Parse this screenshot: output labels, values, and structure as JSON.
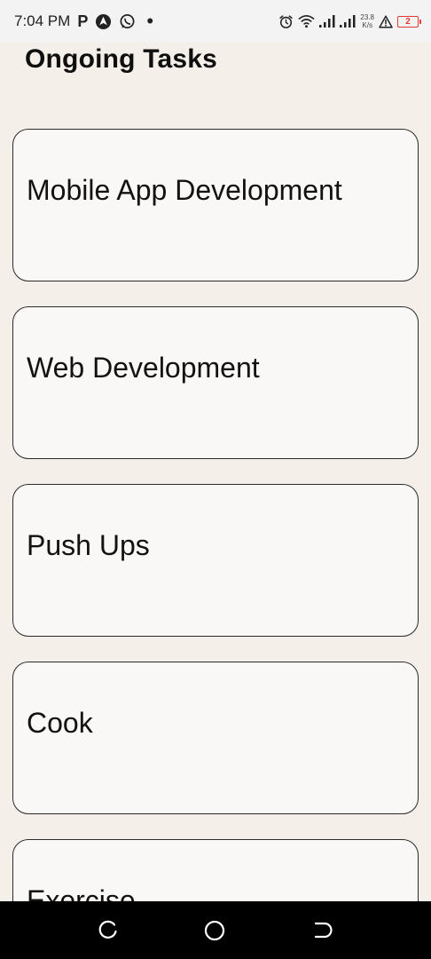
{
  "status_bar": {
    "time": "7:04 PM",
    "net_speed_value": "23.8",
    "net_speed_unit": "K/s",
    "battery_level": "2",
    "battery_color": "#e53935",
    "left_icons": [
      "parking-p-icon",
      "navigation-icon",
      "whatsapp-icon",
      "notification-dot-icon"
    ],
    "right_icons": [
      "alarm-icon",
      "wifi-icon",
      "signal-icon",
      "signal-icon",
      "warning-icon",
      "battery-icon"
    ]
  },
  "header": {
    "title": "Ongoing Tasks"
  },
  "tasks": [
    {
      "label": "Mobile App Development"
    },
    {
      "label": "Web Development"
    },
    {
      "label": "Push Ups"
    },
    {
      "label": "Cook"
    },
    {
      "label": "Exercise"
    }
  ],
  "nav_bar": {
    "buttons": [
      "recent-apps-icon",
      "home-icon",
      "back-icon"
    ]
  },
  "colors": {
    "background": "#f5efea",
    "card_background": "#faf8f6",
    "card_border": "#2a2a2a"
  }
}
